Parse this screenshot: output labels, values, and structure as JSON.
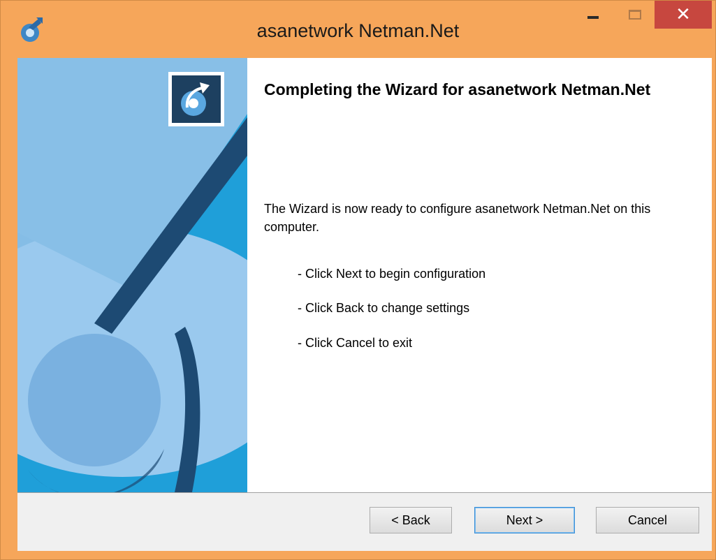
{
  "window": {
    "title": "asanetwork Netman.Net",
    "accent_color": "#f6a65a",
    "close_button_color": "#c7473f",
    "icons": [
      "app-logo-icon",
      "minimize-icon",
      "maximize-icon",
      "close-icon"
    ]
  },
  "wizard": {
    "heading": "Completing the Wizard for asanetwork Netman.Net",
    "description": "The Wizard is now ready to configure asanetwork Netman.Net on this computer.",
    "steps": [
      "- Click Next to begin configuration",
      "- Click Back to change settings",
      "- Click Cancel to exit"
    ]
  },
  "buttons": {
    "back": "< Back",
    "next": "Next >",
    "cancel": "Cancel"
  }
}
